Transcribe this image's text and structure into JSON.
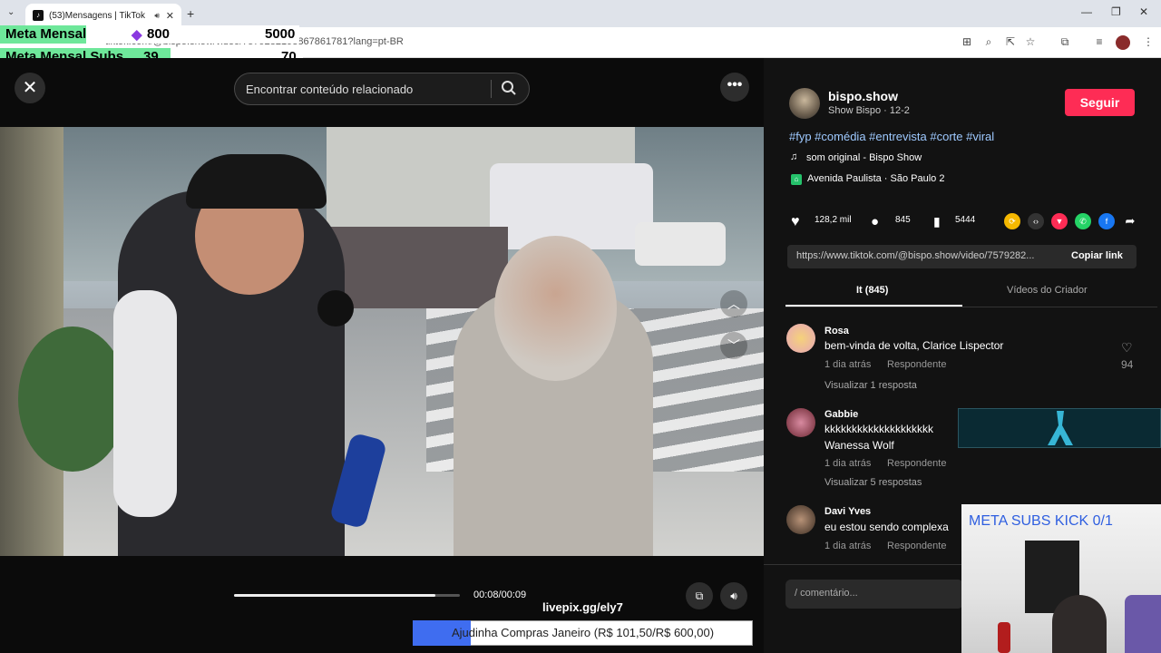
{
  "browser": {
    "tab_title": "(53)Mensagens | TikTok",
    "url": "tiktok.com/@bispo.show/video/7579282198867861781?lang=pt-BR"
  },
  "stream_overlay": {
    "meta_label": "Meta Mensal",
    "meta_current": "800",
    "meta_goal": "5000",
    "subs_label": "Meta Mensal Subs",
    "subs_current": "39",
    "subs_goal": "70",
    "livepix": "livepix.gg/ely7",
    "goal_text": "Ajudinha Compras Janeiro (R$ 101,50/R$ 600,00)",
    "goal_progress": 0.17,
    "webcam_title": "META SUBS KICK 0/1"
  },
  "video": {
    "search_placeholder": "Encontrar conteúdo relacionado",
    "time": "00:08/00:09",
    "progress": 0.89
  },
  "author": {
    "name": "bispo.show",
    "subtitle": "Show Bispo · 12-2",
    "follow_label": "Seguir",
    "hashtags": "#fyp #comédia #entrevista #corte #viral",
    "music": "som original - Bispo Show",
    "location": "Avenida Paulista · São Paulo  2"
  },
  "stats": {
    "likes": "128,2 mil",
    "comments": "845",
    "saves": "5444"
  },
  "link": {
    "url": "https://www.tiktok.com/@bispo.show/video/7579282...",
    "copy_label": "Copiar link"
  },
  "tabs": {
    "comments": "It (845)",
    "creator": "Vídeos do Criador"
  },
  "comments": [
    {
      "name": "Rosa",
      "text": "bem-vinda de volta, Clarice Lispector",
      "time": "1 dia atrás",
      "reply": "Respondente",
      "view": "Visualizar 1 resposta",
      "likes": "94"
    },
    {
      "name": "Gabbie",
      "text": "kkkkkkkkkkkkkkkkkkkk",
      "text2": "Wanessa Wolf",
      "time": "1 dia atrás",
      "reply": "Respondente",
      "view": "Visualizar 5 respostas",
      "likes": ""
    },
    {
      "name": "Davi Yves",
      "text": "eu estou sendo complexa",
      "time": "1 dia atrás",
      "reply": "Respondente",
      "view": "",
      "likes": ""
    }
  ],
  "comment_input": "/  comentário..."
}
